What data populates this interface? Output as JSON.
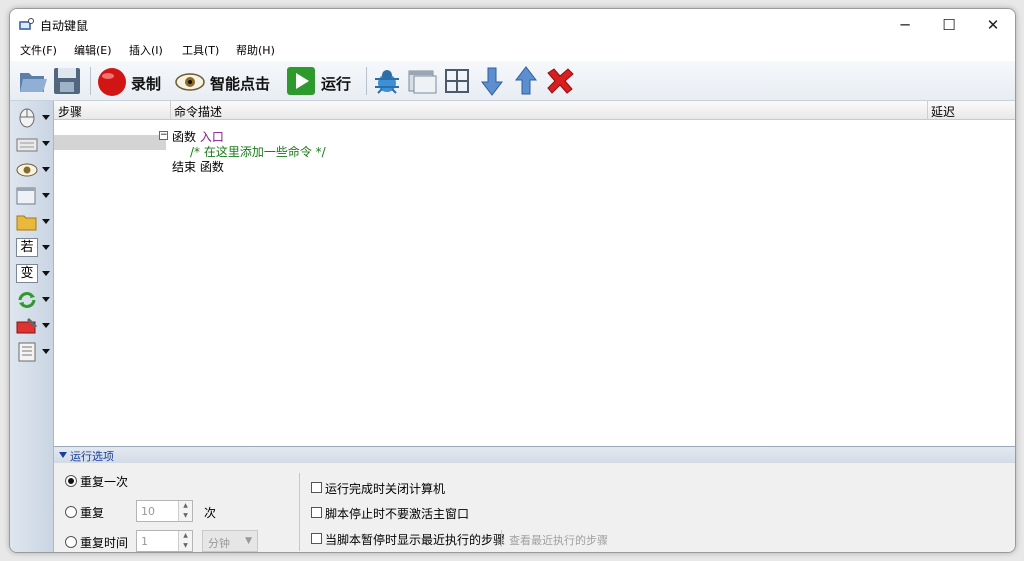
{
  "window": {
    "title": "自动键鼠",
    "icon": "mouse-keyboard-app-icon",
    "controls": {
      "minimize": "─",
      "maximize": "☐",
      "close": "✕"
    }
  },
  "menubar": {
    "items": [
      {
        "label": "文件(F)"
      },
      {
        "label": "编辑(E)"
      },
      {
        "label": "插入(I)"
      },
      {
        "label": "工具(T)"
      },
      {
        "label": "帮助(H)"
      }
    ]
  },
  "toolbar": {
    "open_icon": "folder-open-icon",
    "save_icon": "floppy-disk-icon",
    "record_label": "录制",
    "smart_click_label": "智能点击",
    "run_label": "运行",
    "extra_icons": [
      "spy-bug-icon",
      "window-icon",
      "crosshair-icon",
      "move-down-icon",
      "move-up-icon",
      "delete-icon"
    ]
  },
  "leftbar": {
    "items": [
      {
        "icon": "mouse-icon"
      },
      {
        "icon": "keyboard-icon"
      },
      {
        "icon": "eye-icon"
      },
      {
        "icon": "window-icon"
      },
      {
        "icon": "folder-icon"
      },
      {
        "icon": "condition-icon",
        "char": "若"
      },
      {
        "icon": "variable-icon",
        "char": "变"
      },
      {
        "icon": "loop-icon"
      },
      {
        "icon": "toolbox-icon"
      },
      {
        "icon": "list-icon"
      }
    ]
  },
  "grid": {
    "columns": {
      "step": "步骤",
      "command": "命令描述",
      "delay": "延迟"
    },
    "collapse_glyph": "−",
    "lines": [
      {
        "keyword": "函数",
        "name": "入口"
      },
      {
        "comment": "/* 在这里添加一些命令 */"
      },
      {
        "keyword": "结束 函数"
      }
    ]
  },
  "options": {
    "title": "运行选项",
    "repeat_once": "重复一次",
    "repeat": "重复",
    "repeat_count": "10",
    "times_unit": "次",
    "repeat_time": "重复时间",
    "time_value": "1",
    "time_unit": "分钟",
    "checks": {
      "shutdown": "运行完成时关闭计算机",
      "no_activate": "脚本停止时不要激活主窗口",
      "show_recent": "当脚本暂停时显示最近执行的步骤"
    },
    "view_recent": "查看最近执行的步骤"
  }
}
